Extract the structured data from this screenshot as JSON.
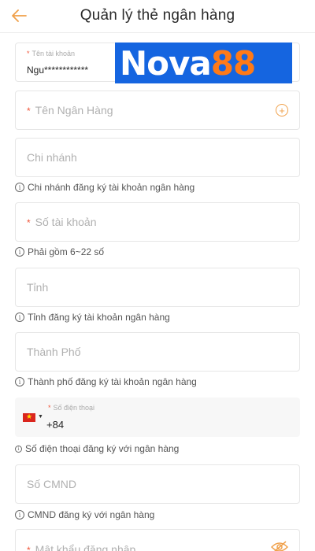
{
  "header": {
    "title": "Quản lý thẻ ngân hàng"
  },
  "brand": {
    "part1": "Nova",
    "part2": "88"
  },
  "fields": {
    "account_name": {
      "label": "Tên tài khoản",
      "value": "Ngu************"
    },
    "bank_name": {
      "placeholder": "Tên Ngân Hàng"
    },
    "branch": {
      "placeholder": "Chi nhánh",
      "hint": "Chi nhánh đăng ký tài khoản ngân hàng"
    },
    "account_number": {
      "placeholder": "Số tài khoản",
      "hint": "Phải gồm 6~22 số"
    },
    "province": {
      "placeholder": "Tỉnh",
      "hint": "Tỉnh đăng ký tài khoản ngân hàng"
    },
    "city": {
      "placeholder": "Thành Phố",
      "hint": "Thành phố đăng ký tài khoản ngân hàng"
    },
    "phone": {
      "label": "Số điện thoại",
      "code": "+84",
      "hint": "Số điện thoại đăng ký với ngân hàng"
    },
    "id_number": {
      "placeholder": "Số CMND",
      "hint": "CMND đăng ký với ngân hàng"
    },
    "login_password": {
      "placeholder": "Mật khẩu đăng nhập"
    }
  },
  "required_mark": "*",
  "colors": {
    "accent": "#f0a04a",
    "required": "#f0563a",
    "brand_blue": "#1565e0",
    "brand_orange": "#ff7a18"
  },
  "icons": [
    "back-arrow-icon",
    "add-circle-icon",
    "info-icon",
    "vietnam-flag-icon",
    "chevron-down-icon",
    "eye-icon"
  ]
}
